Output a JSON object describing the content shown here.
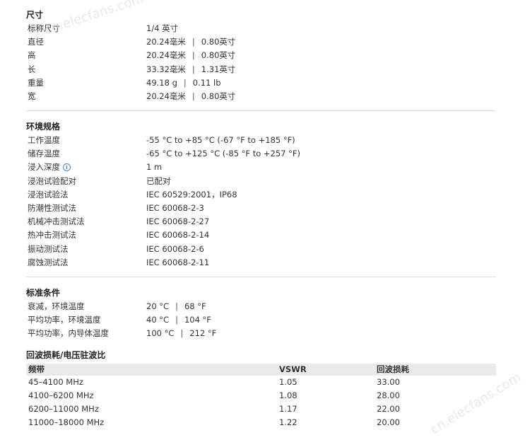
{
  "dimensions": {
    "title": "尺寸",
    "rows": [
      {
        "label": "标称尺寸",
        "value": "1/4 英寸"
      },
      {
        "label": "直径",
        "metric": "20.24毫米",
        "imperial": "0.80英寸"
      },
      {
        "label": "高",
        "metric": "20.24毫米",
        "imperial": "0.80英寸"
      },
      {
        "label": "长",
        "metric": "33.32毫米",
        "imperial": "1.31英寸"
      },
      {
        "label": "重量",
        "metric": "49.18 g",
        "imperial": "0.11 lb"
      },
      {
        "label": "宽",
        "metric": "20.24毫米",
        "imperial": "0.80英寸"
      }
    ]
  },
  "environment": {
    "title": "环境规格",
    "rows": [
      {
        "label": "工作温度",
        "value": "-55 °C to +85 °C (-67 °F to +185 °F)"
      },
      {
        "label": "储存温度",
        "value": "-65 °C to +125 °C (-85 °F to +257 °F)"
      },
      {
        "label": "浸入深度",
        "value": "1 m",
        "info_icon": "info-icon"
      },
      {
        "label": "浸泡试验配对",
        "value": "已配对"
      },
      {
        "label": "浸泡试验法",
        "value": "IEC 60529:2001，IP68"
      },
      {
        "label": "防潮性测试法",
        "value": "IEC 60068-2-3"
      },
      {
        "label": "机械冲击测试法",
        "value": "IEC 60068-2-27"
      },
      {
        "label": "热冲击测试法",
        "value": "IEC 60068-2-14"
      },
      {
        "label": "振动测试法",
        "value": "IEC 60068-2-6"
      },
      {
        "label": "腐蚀测试法",
        "value": "IEC 60068-2-11"
      }
    ]
  },
  "standard_conditions": {
    "title": "标准条件",
    "rows": [
      {
        "label": "衰减，环境温度",
        "metric": "20 °C",
        "imperial": "68 °F"
      },
      {
        "label": "平均功率，环境温度",
        "metric": "40 °C",
        "imperial": "104 °F"
      },
      {
        "label": "平均功率，内导体温度",
        "metric": "100 °C",
        "imperial": "212 °F"
      }
    ]
  },
  "return_loss": {
    "title": "回波损耗/电压驻波比",
    "headers": [
      "频带",
      "VSWR",
      "回波损耗"
    ],
    "rows": [
      [
        "45–4100 MHz",
        "1.05",
        "33.00"
      ],
      [
        "4100–6200 MHz",
        "1.08",
        "28.00"
      ],
      [
        "6200–11000 MHz",
        "1.17",
        "22.00"
      ],
      [
        "11000–18000 MHz",
        "1.22",
        "20.00"
      ]
    ]
  },
  "separator": "|",
  "watermark": "cn.elecfans.com"
}
